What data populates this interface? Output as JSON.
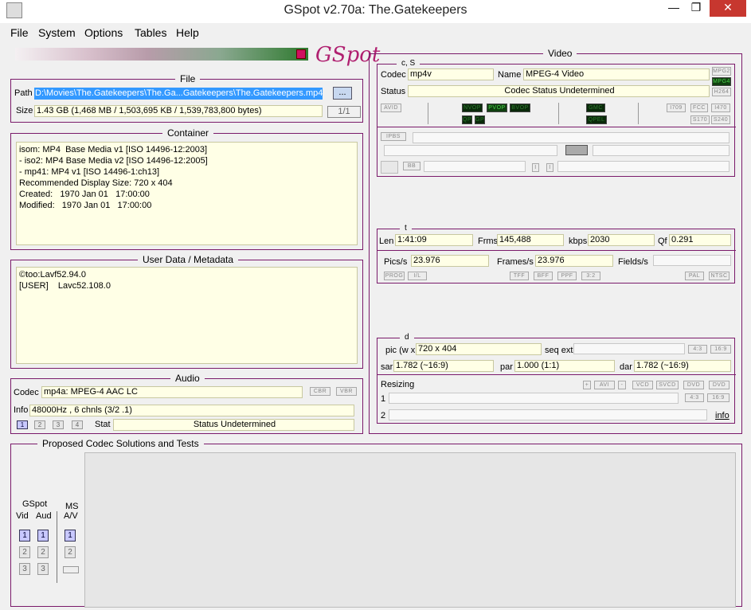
{
  "window": {
    "title": "GSpot v2.70a: The.Gatekeepers",
    "minimize": "—",
    "maximize": "❐",
    "close": "✕"
  },
  "menu": [
    "File",
    "System",
    "Options",
    "Tables",
    "Help"
  ],
  "logo_text": "GSpot",
  "file": {
    "title": "File",
    "path_label": "Path",
    "path_value": "D:\\Movies\\The.Gatekeepers\\The.Ga...Gatekeepers\\The.Gatekeepers.mp4",
    "browse_label": "...",
    "size_label": "Size",
    "size_value": "1.43 GB (1,468 MB / 1,503,695 KB / 1,539,783,800 bytes)",
    "page": "1/1"
  },
  "container": {
    "title": "Container",
    "text": "isom: MP4  Base Media v1 [ISO 14496-12:2003]\n- iso2: MP4 Base Media v2 [ISO 14496-12:2005]\n- mp41: MP4 v1 [ISO 14496-1:ch13]\nRecommended Display Size: 720 x 404\nCreated:   1970 Jan 01   17:00:00\nModified:   1970 Jan 01   17:00:00"
  },
  "metadata": {
    "title": "User Data / Metadata",
    "text": "©too:Lavf52.94.0\n[USER]    Lavc52.108.0"
  },
  "audio": {
    "title": "Audio",
    "codec_label": "Codec",
    "codec_value": "mp4a: MPEG-4 AAC LC",
    "cbr": "CBR",
    "vbr": "VBR",
    "info_label": "Info",
    "info_value": "48000Hz  , 6 chnls (3/2 .1)",
    "streams": [
      "1",
      "2",
      "3",
      "4"
    ],
    "stat_label": "Stat",
    "stat_value": "Status Undetermined"
  },
  "video": {
    "title": "Video",
    "cs_title": "c, S",
    "codec_label": "Codec",
    "codec_value": "mp4v",
    "name_label": "Name",
    "name_value": "MPEG-4 Video",
    "status_label": "Status",
    "status_value": "Codec Status Undetermined",
    "flags_right": [
      "MPG2",
      "MPG4",
      "H264"
    ],
    "avid": "AVID",
    "vops": [
      "NVOP",
      "PVOP",
      "BVOP"
    ],
    "qp": [
      "QP",
      "GP"
    ],
    "gmc": "GMC",
    "qpel": "QPEL",
    "std_flags": [
      "I709",
      "FCC",
      "I470",
      "S170",
      "S240"
    ],
    "ipbs": "IPBS",
    "bb": "BB",
    "i_markers": [
      "I",
      "I"
    ],
    "t_title": "t",
    "len_label": "Len",
    "len_value": "1:41:09",
    "frms_label": "Frms",
    "frms_value": "145,488",
    "kbps_label": "kbps",
    "kbps_value": "2030",
    "qf_label": "Qf",
    "qf_value": "0.291",
    "pics_label": "Pics/s",
    "pics_value": "23.976",
    "frames_label": "Frames/s",
    "frames_value": "23.976",
    "fields_label": "Fields/s",
    "t_flags": [
      "PROG",
      "I/L",
      "TFF",
      "BFF",
      "PPF",
      "3:2",
      "PAL",
      "NTSC"
    ],
    "d_title": "d",
    "pic_label": "pic (w x",
    "pic_value": "720 x 404",
    "seq_label": "seq ext",
    "ratio_flags": [
      "4:3",
      "16:9"
    ],
    "sar_label": "sar",
    "sar_value": "1.782 (~16:9)",
    "par_label": "par",
    "par_value": "1.000 (1:1)",
    "dar_label": "dar",
    "dar_value": "1.782 (~16:9)",
    "resizing_label": "Resizing",
    "resize_flags": [
      "+",
      "AVI",
      "-",
      "VCD",
      "SVCD",
      "DVD",
      "DVD"
    ],
    "row1": "1",
    "row2": "2",
    "info_link": "info"
  },
  "codec_solutions": {
    "title": "Proposed Codec Solutions and Tests",
    "gspot_label": "GSpot",
    "vid_label": "Vid",
    "aud_label": "Aud",
    "ms_label": "MS",
    "av_label": "A/V",
    "buttons": [
      "1",
      "2",
      "3"
    ]
  },
  "colors": {
    "accent": "#7a1a6a",
    "field_bg": "#ffffe6",
    "path_select": "#3399ff",
    "close_red": "#c7372f"
  }
}
